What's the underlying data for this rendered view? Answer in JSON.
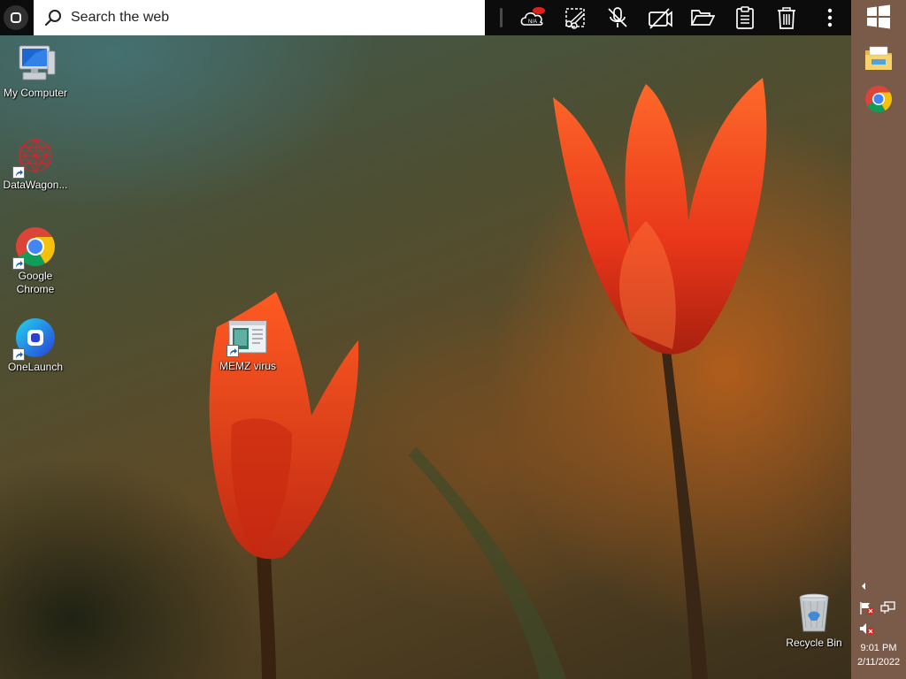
{
  "search": {
    "placeholder": "Search the web"
  },
  "toolbar": {
    "cloud_badge": "N/A",
    "tools": [
      "cloud-status",
      "snip",
      "mic-off",
      "camera-off",
      "open-folder",
      "clipboard",
      "trash",
      "more"
    ]
  },
  "desktop": {
    "icons": [
      {
        "label": "My Computer",
        "icon": "computer-icon"
      },
      {
        "label": "DataWagon...",
        "icon": "datawagon-icon"
      },
      {
        "label": "Google Chrome",
        "icon": "chrome-icon"
      },
      {
        "label": "OneLaunch",
        "icon": "onelaunch-icon"
      },
      {
        "label": "MEMZ virus",
        "icon": "memz-icon"
      },
      {
        "label": "Recycle Bin",
        "icon": "recycle-bin-icon"
      }
    ]
  },
  "taskbar": {
    "pinned": [
      "windows-start-icon",
      "file-explorer-icon",
      "chrome-icon"
    ],
    "clock": {
      "time": "9:01 PM",
      "date": "2/11/2022"
    }
  },
  "colors": {
    "topbar": "#0c0c0c",
    "sidebar": "#7a5a48",
    "badge_red": "#e0201a"
  }
}
